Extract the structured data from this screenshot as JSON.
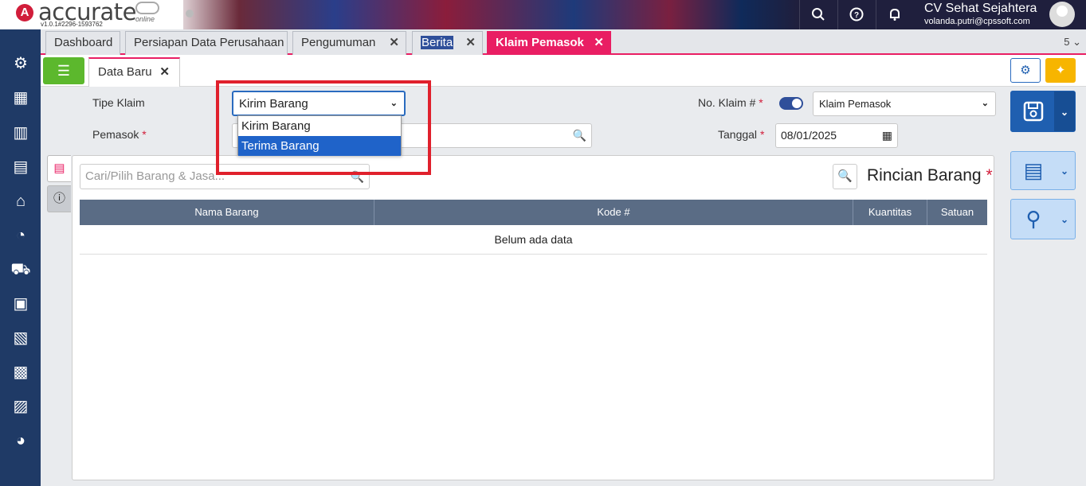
{
  "app": {
    "logo_text": "accurate",
    "logo_sub": "online",
    "version": "v1.0.1#2296-1593762",
    "company": "CV Sehat Sejahtera",
    "email": "volanda.putri@cpssoft.com"
  },
  "tabs": [
    {
      "label": "Dashboard"
    },
    {
      "label": "Persiapan Data Perusahaan"
    },
    {
      "label": "Pengumuman"
    },
    {
      "label": "Berita"
    },
    {
      "label": "Klaim Pemasok"
    }
  ],
  "tab_count": "5",
  "subtab": {
    "label": "Data Baru"
  },
  "form": {
    "tipe_klaim_label": "Tipe Klaim",
    "tipe_klaim_value": "Kirim Barang",
    "tipe_klaim_options": [
      "Kirim Barang",
      "Terima Barang"
    ],
    "tipe_klaim_highlighted": "Terima Barang",
    "pemasok_label": "Pemasok",
    "no_klaim_label": "No. Klaim #",
    "no_klaim_value": "Klaim Pemasok",
    "tanggal_label": "Tanggal",
    "tanggal_value": "08/01/2025"
  },
  "items": {
    "search_placeholder": "Cari/Pilih Barang & Jasa...",
    "section_title": "Rincian Barang",
    "columns": [
      "Nama Barang",
      "Kode #",
      "Kuantitas",
      "Satuan"
    ],
    "empty_text": "Belum ada data"
  },
  "colors": {
    "accent": "#e91e63",
    "nav": "#1f3a66",
    "primary": "#1f5fb0",
    "highlight_box": "#e0202c"
  }
}
